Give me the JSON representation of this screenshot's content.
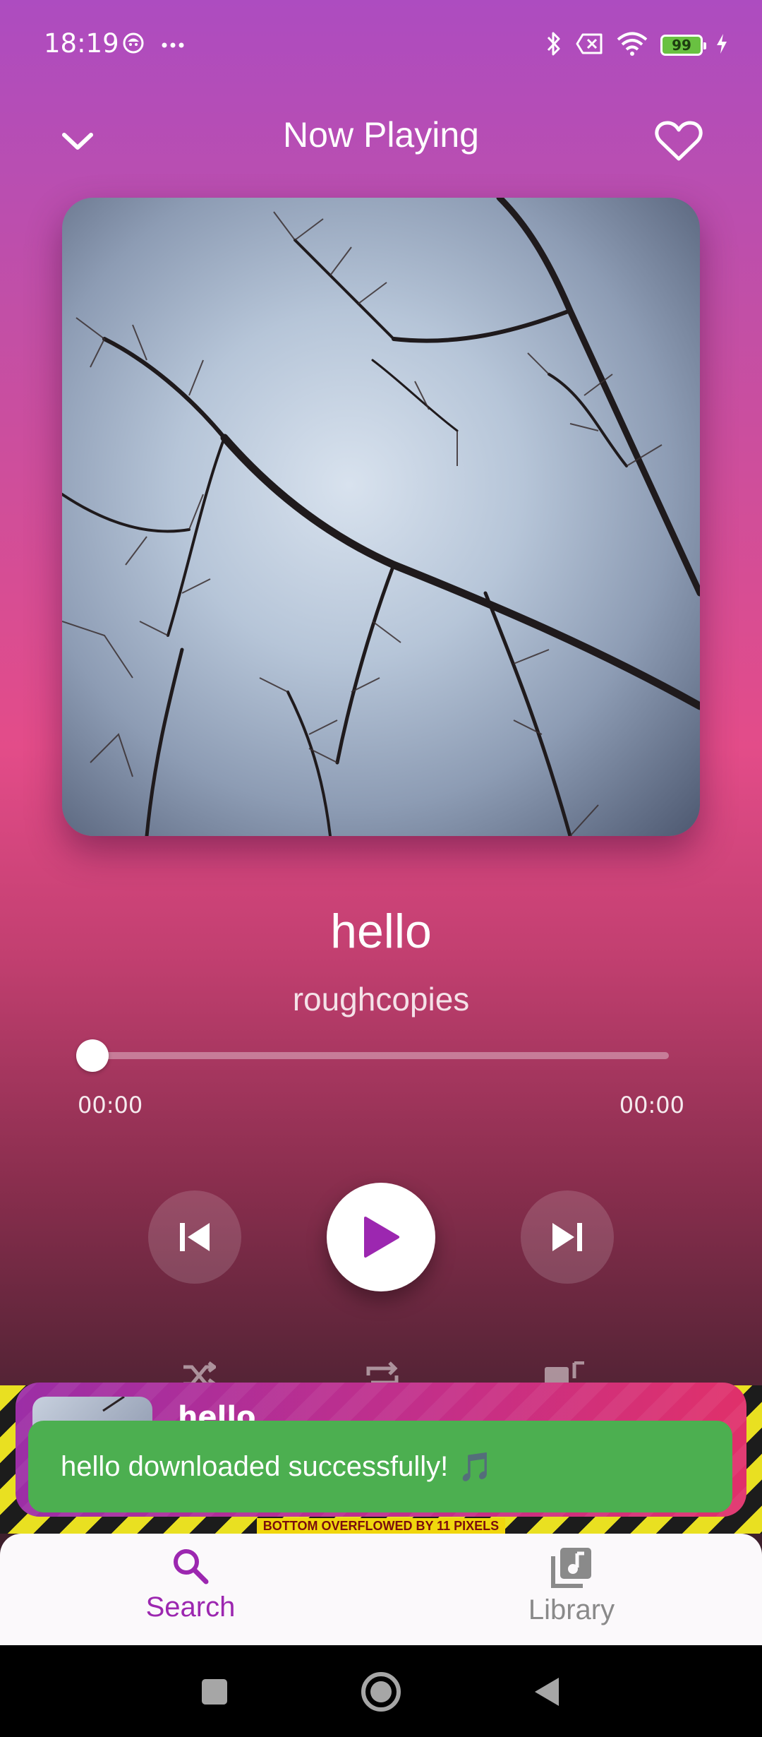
{
  "status_bar": {
    "time": "18:19",
    "battery_level": "99",
    "battery_color": "#69c141",
    "left_icons": [
      "face-notification-icon",
      "more-dots-icon"
    ],
    "right_icons": [
      "bluetooth-icon",
      "sim-blocked-icon",
      "wifi-icon",
      "battery-icon",
      "charging-icon"
    ]
  },
  "header": {
    "title": "Now Playing",
    "collapse_icon": "chevron-down-icon",
    "favorite_icon": "heart-outline-icon"
  },
  "track": {
    "title": "hello",
    "artist": "roughcopies",
    "current_time": "00:00",
    "total_time": "00:00",
    "progress": 0
  },
  "controls": {
    "previous_icon": "skip-previous-icon",
    "play_icon": "play-icon",
    "next_icon": "skip-next-icon",
    "shuffle_icon": "shuffle-icon",
    "repeat_icon": "repeat-icon",
    "queue_icon": "queue-music-icon",
    "accent": "#9c27b0"
  },
  "mini_player": {
    "title": "hello"
  },
  "overflow_warning": "BOTTOM OVERFLOWED BY 11 PIXELS",
  "snackbar": {
    "message": "hello downloaded successfully!",
    "emoji": "🎵",
    "color": "#4caf50"
  },
  "bottom_nav": {
    "items": [
      {
        "label": "Search",
        "icon": "search-icon",
        "active": true,
        "color": "#9c27b0"
      },
      {
        "label": "Library",
        "icon": "library-music-icon",
        "active": false,
        "color": "#8a8a8a"
      }
    ]
  },
  "system_nav": [
    "recents-square-icon",
    "home-circle-icon",
    "back-triangle-icon"
  ]
}
